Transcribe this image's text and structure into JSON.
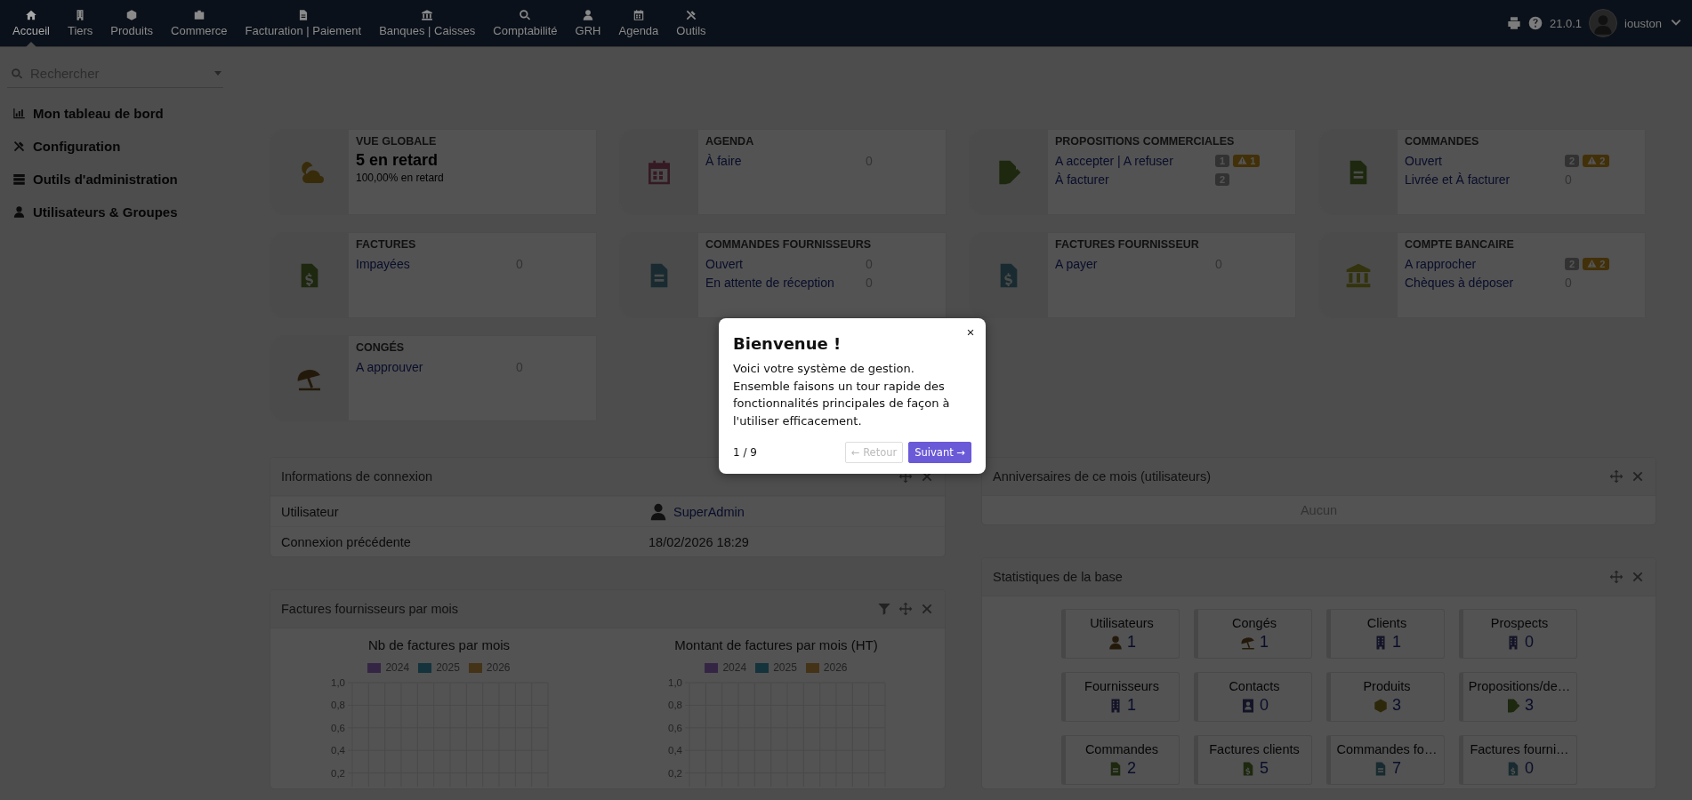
{
  "top_menu": {
    "items": [
      {
        "label": "Accueil",
        "selected": true
      },
      {
        "label": "Tiers",
        "selected": false
      },
      {
        "label": "Produits",
        "selected": false
      },
      {
        "label": "Commerce",
        "selected": false
      },
      {
        "label": "Facturation | Paiement",
        "selected": false
      },
      {
        "label": "Banques | Caisses",
        "selected": false
      },
      {
        "label": "Comptabilité",
        "selected": false
      },
      {
        "label": "GRH",
        "selected": false
      },
      {
        "label": "Agenda",
        "selected": false
      },
      {
        "label": "Outils",
        "selected": false
      }
    ],
    "version": "21.0.1",
    "user": "iouston"
  },
  "sidebar": {
    "search": {
      "placeholder": "Rechercher"
    },
    "items": [
      {
        "label": "Mon tableau de bord"
      },
      {
        "label": "Configuration"
      },
      {
        "label": "Outils d'administration"
      },
      {
        "label": "Utilisateurs & Groupes"
      }
    ]
  },
  "cards": [
    {
      "kind": "summary",
      "title": "VUE GLOBALE",
      "headline": "5 en retard",
      "subline": "100,00% en retard"
    },
    {
      "kind": "list",
      "title": "AGENDA",
      "lines": [
        {
          "label": "À faire",
          "value": "0"
        }
      ]
    },
    {
      "kind": "list",
      "title": "PROPOSITIONS COMMERCIALES",
      "lines": [
        {
          "label": "A accepter | A refuser",
          "badges": [
            {
              "kind": "count",
              "text": "1"
            },
            {
              "kind": "late",
              "text": "1"
            }
          ]
        },
        {
          "label": "À facturer",
          "badges": [
            {
              "kind": "count",
              "text": "2"
            }
          ]
        }
      ]
    },
    {
      "kind": "list",
      "title": "COMMANDES",
      "lines": [
        {
          "label": "Ouvert",
          "badges": [
            {
              "kind": "count",
              "text": "2"
            },
            {
              "kind": "late",
              "text": "2"
            }
          ]
        },
        {
          "label": "Livrée et À facturer",
          "value": "0"
        }
      ]
    },
    {
      "kind": "list",
      "title": "FACTURES",
      "lines": [
        {
          "label": "Impayées",
          "value": "0"
        }
      ]
    },
    {
      "kind": "list",
      "title": "COMMANDES FOURNISSEURS",
      "lines": [
        {
          "label": "Ouvert",
          "value": "0"
        },
        {
          "label": "En attente de réception",
          "value": "0"
        }
      ]
    },
    {
      "kind": "list",
      "title": "FACTURES FOURNISSEUR",
      "lines": [
        {
          "label": "A payer",
          "value": "0"
        }
      ]
    },
    {
      "kind": "list",
      "title": "COMPTE BANCAIRE",
      "lines": [
        {
          "label": "A rapprocher",
          "badges": [
            {
              "kind": "count",
              "text": "2"
            },
            {
              "kind": "late",
              "text": "2"
            }
          ]
        },
        {
          "label": "Chèques à déposer",
          "value": "0"
        }
      ]
    },
    {
      "kind": "list",
      "title": "CONGÉS",
      "lines": [
        {
          "label": "A approuver",
          "value": "0"
        }
      ]
    }
  ],
  "login_box": {
    "title": "Informations de connexion",
    "rows": [
      {
        "kind": "user",
        "label": "Utilisateur",
        "value": "SuperAdmin"
      },
      {
        "kind": "text",
        "label": "Connexion précédente",
        "value": "18/02/2026 18:29"
      }
    ]
  },
  "chart_box": {
    "title": "Factures fournisseurs par mois",
    "charts": [
      {
        "chart_data": {
          "type": "bar",
          "grid": true,
          "title": "Nb de factures par mois",
          "series": [
            {
              "name": "2024",
              "color": "#a070d0"
            },
            {
              "name": "2025",
              "color": "#3e9ab8"
            },
            {
              "name": "2026",
              "color": "#d09a48"
            }
          ],
          "ylim": [
            0,
            1
          ],
          "yticks": [
            {
              "value": 1,
              "label": "1,0"
            },
            {
              "value": 0.8,
              "label": "0,8"
            },
            {
              "value": 0.6,
              "label": "0,6"
            },
            {
              "value": 0.4,
              "label": "0,4"
            },
            {
              "value": 0.2,
              "label": "0,2"
            }
          ]
        }
      },
      {
        "chart_data": {
          "type": "bar",
          "grid": true,
          "title": "Montant de factures par mois (HT)",
          "series": [
            {
              "name": "2024",
              "color": "#a070d0"
            },
            {
              "name": "2025",
              "color": "#3e9ab8"
            },
            {
              "name": "2026",
              "color": "#d09a48"
            }
          ],
          "ylim": [
            0,
            1
          ],
          "yticks": [
            {
              "value": 1,
              "label": "1,0"
            },
            {
              "value": 0.8,
              "label": "0,8"
            },
            {
              "value": 0.6,
              "label": "0,6"
            },
            {
              "value": 0.4,
              "label": "0,4"
            },
            {
              "value": 0.2,
              "label": "0,2"
            }
          ]
        }
      }
    ]
  },
  "birthday_box": {
    "title": "Anniversaires de ce mois (utilisateurs)",
    "empty_text": "Aucun"
  },
  "stats_box": {
    "title": "Statistiques de la base",
    "tiles": [
      {
        "label": "Utilisateurs",
        "count": "1"
      },
      {
        "label": "Congés",
        "count": "1"
      },
      {
        "label": "Clients",
        "count": "1"
      },
      {
        "label": "Prospects",
        "count": "0"
      },
      {
        "label": "Fournisseurs",
        "count": "1"
      },
      {
        "label": "Contacts",
        "count": "0"
      },
      {
        "label": "Produits",
        "count": "3"
      },
      {
        "label": "Propositions/de…",
        "count": "3"
      },
      {
        "label": "Commandes",
        "count": "2"
      },
      {
        "label": "Factures clients",
        "count": "5"
      },
      {
        "label": "Commandes fo…",
        "count": "7"
      },
      {
        "label": "Factures fourni…",
        "count": "0"
      }
    ]
  },
  "tour_dialog": {
    "title": "Bienvenue !",
    "text": "Voici votre système de gestion. Ensemble faisons un tour rapide des fonctionnalités principales de façon à l'utiliser efficacement.",
    "step": "1 / 9",
    "buttons": [
      {
        "label": "← Retour",
        "disabled": true
      },
      {
        "label": "Suivant →",
        "disabled": false
      }
    ]
  }
}
